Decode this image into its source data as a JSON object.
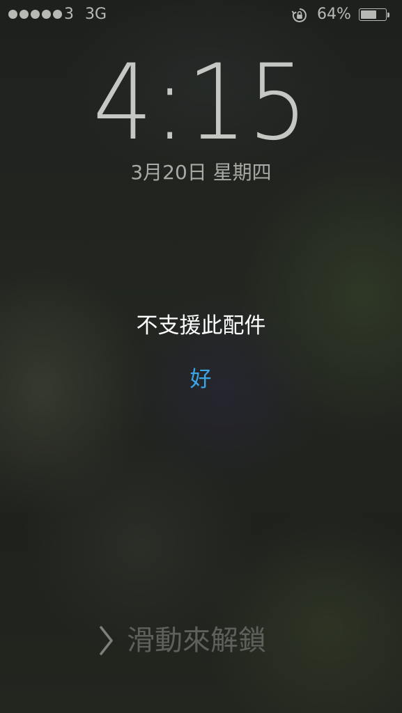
{
  "status_bar": {
    "carrier": "3",
    "network": "3G",
    "battery_percent": "64%",
    "battery_level": 0.64,
    "signal_bars": 5,
    "icons": [
      "signal-dots-icon",
      "rotation-lock-icon",
      "battery-icon"
    ]
  },
  "lock_screen": {
    "time": "4:15",
    "date": "3月20日 星期四"
  },
  "alert": {
    "title": "不支援此配件",
    "ok_label": "好",
    "ok_color": "#3aa6e6"
  },
  "unlock": {
    "label": "滑動來解鎖",
    "icon": "chevron-right-icon"
  }
}
